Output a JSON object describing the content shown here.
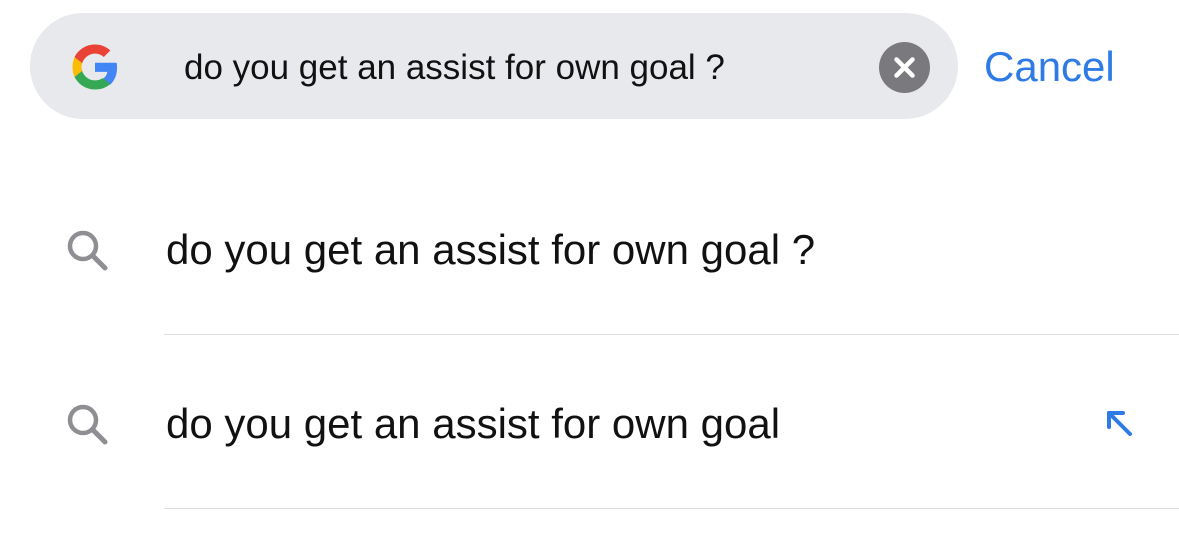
{
  "search": {
    "query": "do you get an assist for own goal ?",
    "logo_icon": "google-g-icon",
    "clear_icon": "clear-x-icon",
    "cancel_label": "Cancel"
  },
  "suggestions": [
    {
      "text": "do you get an assist for own goal ?",
      "icon": "search-icon"
    },
    {
      "text": "do you get an assist for own goal",
      "icon": "search-icon",
      "fill_icon": "arrow-up-left-icon"
    }
  ],
  "colors": {
    "search_bar_bg": "#e8e9ed",
    "accent": "#2f7be6",
    "clear_button": "#7a7a7e",
    "icon_gray": "#8e8e93"
  }
}
